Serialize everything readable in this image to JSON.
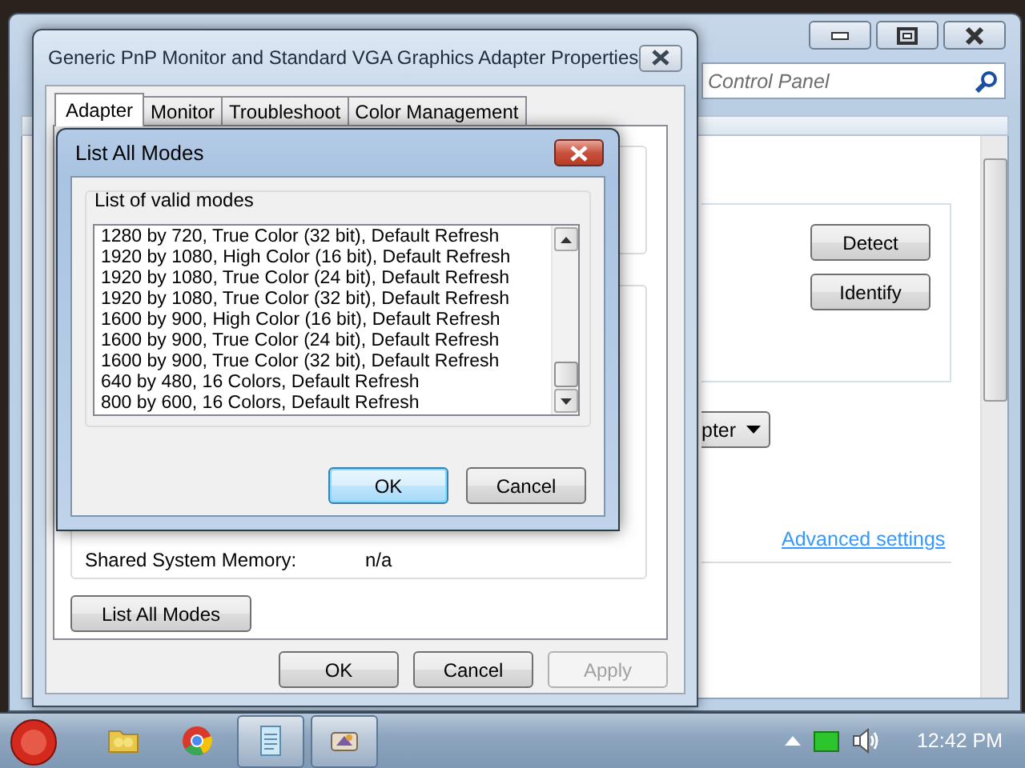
{
  "control_panel": {
    "search": {
      "placeholder": "Control Panel"
    },
    "buttons": [
      "Detect",
      "Identify"
    ],
    "dropdown": {
      "value": "pter"
    },
    "link": "Advanced settings"
  },
  "properties_dialog": {
    "title": "Generic PnP Monitor and Standard VGA Graphics Adapter Properties",
    "tabs": [
      {
        "label": "Adapter",
        "selected": true
      },
      {
        "label": "Monitor",
        "selected": false
      },
      {
        "label": "Troubleshoot",
        "selected": false
      },
      {
        "label": "Color Management",
        "selected": false
      }
    ],
    "fields": [
      {
        "label": "Shared System Memory:",
        "value": "n/a"
      }
    ],
    "list_modes_button": "List All Modes",
    "buttons": [
      {
        "label": "OK",
        "disabled": false
      },
      {
        "label": "Cancel",
        "disabled": false
      },
      {
        "label": "Apply",
        "disabled": true
      }
    ]
  },
  "modes_dialog": {
    "title": "List All Modes",
    "group_label": "List of valid modes",
    "modes": [
      "1280 by 720, True Color (32 bit), Default Refresh",
      "1920 by 1080, High Color (16 bit), Default Refresh",
      "1920 by 1080, True Color (24 bit), Default Refresh",
      "1920 by 1080, True Color (32 bit), Default Refresh",
      "1600 by 900, High Color (16 bit), Default Refresh",
      "1600 by 900, True Color (24 bit), Default Refresh",
      "1600 by 900, True Color (32 bit), Default Refresh",
      "640 by 480, 16 Colors, Default Refresh",
      "800 by 600, 16 Colors, Default Refresh"
    ],
    "buttons": [
      {
        "label": "OK",
        "default": true
      },
      {
        "label": "Cancel",
        "default": false
      }
    ]
  },
  "taskbar": {
    "apps": [
      {
        "kind": "folder",
        "open": false
      },
      {
        "kind": "browser",
        "open": false
      },
      {
        "kind": "notepad",
        "open": true
      },
      {
        "kind": "paint",
        "open": true
      }
    ],
    "clock": "12:42 PM"
  }
}
